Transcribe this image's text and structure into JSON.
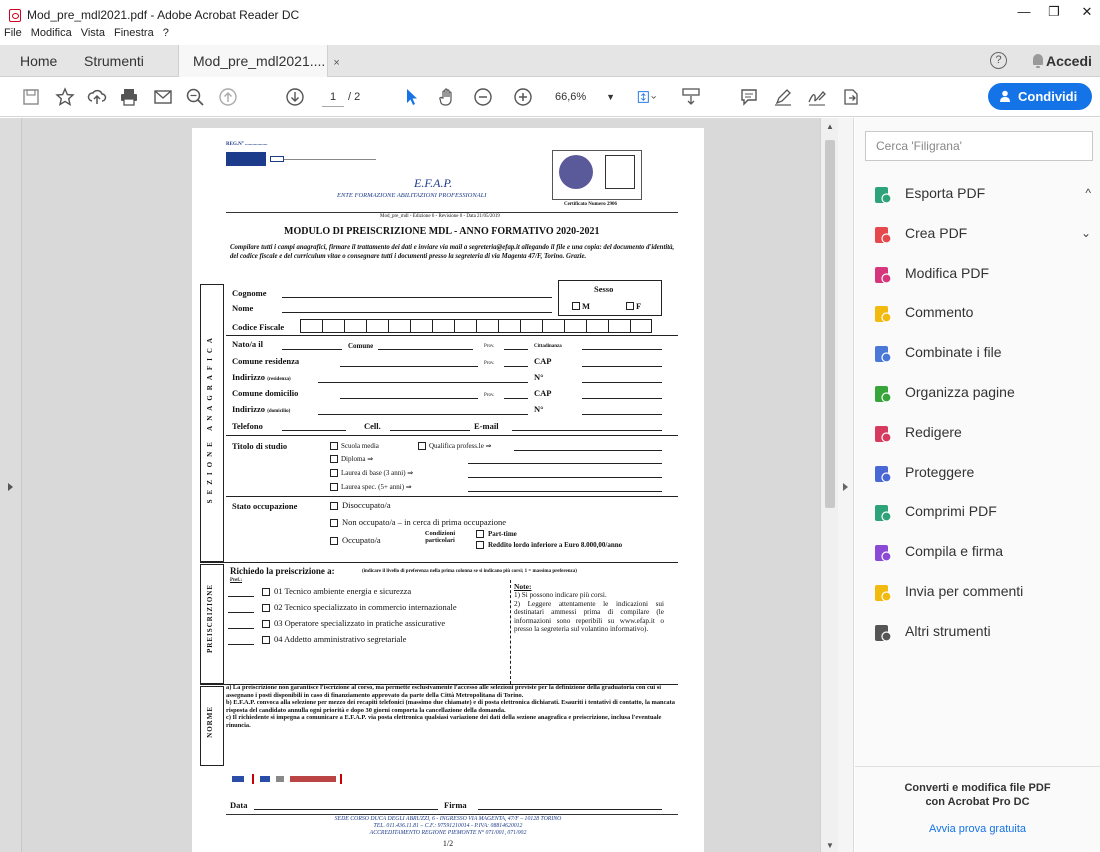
{
  "window": {
    "title": "Mod_pre_mdl2021.pdf - Adobe Acrobat Reader DC",
    "controls": [
      "—",
      "❐",
      "✕"
    ]
  },
  "menu": [
    "File",
    "Modifica",
    "Vista",
    "Finestra",
    "?"
  ],
  "tabs": {
    "home": "Home",
    "tools": "Strumenti",
    "doc": "Mod_pre_mdl2021....",
    "doc_close": "×",
    "signin": "Accedi",
    "help": "?"
  },
  "toolbar": {
    "page_current": "1",
    "page_total": "/ 2",
    "zoom": "66,6%",
    "share": "Condividi"
  },
  "right_panel": {
    "search_placeholder": "Cerca 'Filigrana'",
    "tools": [
      {
        "label": "Esporta PDF",
        "color": "#2ea37a",
        "chevron": "^"
      },
      {
        "label": "Crea PDF",
        "color": "#e5484d",
        "chevron": "⌄"
      },
      {
        "label": "Modifica PDF",
        "color": "#d6367c"
      },
      {
        "label": "Commento",
        "color": "#f2b90f"
      },
      {
        "label": "Combinate i file",
        "color": "#4a78d8"
      },
      {
        "label": "Organizza pagine",
        "color": "#37a63a"
      },
      {
        "label": "Redigere",
        "color": "#d63b5f"
      },
      {
        "label": "Proteggere",
        "color": "#4a67d6"
      },
      {
        "label": "Comprimi PDF",
        "color": "#2ea37a"
      },
      {
        "label": "Compila e firma",
        "color": "#8a4ad6"
      },
      {
        "label": "Invia per commenti",
        "color": "#f2b90f"
      },
      {
        "label": "Altri strumenti",
        "color": "#555555"
      }
    ],
    "footer_title": "Converti e modifica file PDF con Acrobat Pro DC",
    "footer_link": "Avvia prova gratuita"
  },
  "pdf": {
    "reg": "REG.N° ..................",
    "org_abbr": "E.F.A.P.",
    "org_name": "ENTE FORMAZIONE ABILITAZIONI PROFESSIONALI",
    "cert": "Certificato Numero 2906",
    "mod_line": "Mod_pre_mdl - Edizione 6 - Revisione 0 - Data 21/05/2019",
    "title": "MODULO DI PREISCRIZIONE MDL - ANNO FORMATIVO 2020-2021",
    "intro": "Compilare tutti i campi anagrafici, firmare il trattamento dei dati e inviare via mail a segreteria@efap.it allegando il file e una copia: del documento d'identità, del codice fiscale e del curriculum vitae o consegnare tutti i documenti presso la segreteria di via Magenta 47/F, Torino. Grazie.",
    "sections": {
      "anagrafica": "SEZIONE ANAGRAFICA",
      "prescrizione": "PREISCRIZIONE",
      "norme": "NORME"
    },
    "fields": {
      "cognome": "Cognome",
      "nome": "Nome",
      "sesso": "Sesso",
      "m": "M",
      "f": "F",
      "codice_fiscale": "Codice Fiscale",
      "nato": "Nato/a il",
      "comune": "Comune",
      "prov": "Prov.",
      "cittadinanza": "Cittadinanza",
      "comune_res": "Comune residenza",
      "cap": "CAP",
      "indirizzo": "Indirizzo",
      "residenza": "(residenza)",
      "n": "N°",
      "comune_dom": "Comune domicilio",
      "domicilio": "(domicilio)",
      "telefono": "Telefono",
      "cell": "Cell.",
      "email": "E-mail"
    },
    "studio": {
      "label": "Titolo di studio",
      "opts": [
        "Scuola media",
        "Qualifica profess.le ⇒",
        "Diploma ⇒",
        "Laurea di base (3 anni) ⇒",
        "Laurea spec. (5+ anni) ⇒"
      ]
    },
    "occupazione": {
      "label": "Stato occupazione",
      "opts": [
        "Disoccupato/a",
        "Non occupato/a – in cerca di prima occupazione",
        "Occupato/a"
      ],
      "cond": "Condizioni particolari",
      "part": "Part-time",
      "reddito": "Reddito lordo inferiore a Euro 8.000,00/anno"
    },
    "richiedo": "Richiedo la preiscrizione a:",
    "richiedo_note": "(indicare il livello di preferenza nella prima colonna se si indicano più corsi; 1 = massima preferenza)",
    "pref": "Pref.:",
    "corsi": [
      "01 Tecnico ambiente energia e sicurezza",
      "02 Tecnico specializzato in commercio internazionale",
      "03 Operatore specializzato in pratiche assicurative",
      "04 Addetto amministrativo segretariale"
    ],
    "note_title": "Note:",
    "notes": [
      "1)  Si possono indicare più corsi.",
      "2)  Leggere attentamente le indicazioni sui destinatari ammessi prima di compilare (le informazioni sono reperibili su www.efap.it o presso la segreteria sul volantino informativo)."
    ],
    "norme": [
      "a)  La preiscrizione non garantisce l'iscrizione al corso, ma permette esclusivamente l'accesso alle selezioni previste per la definizione della graduatoria con cui si assegnano i posti disponibili in caso di finanziamento approvato da parte della Città Metropolitana di Torino.",
      "b)  E.F.A.P. convoca alla selezione per mezzo dei recapiti telefonici (massimo due chiamate) e di posta elettronica dichiarati. Esauriti i tentativi di contatto, la mancata risposta del candidato annulla ogni priorità e dopo 30 giorni comporta la cancellazione della domanda.",
      "c)  Il richiedente si impegna a comunicare a E.F.A.P. via posta elettronica qualsiasi variazione dei dati della sezione anagrafica e preiscrizione, inclusa l'eventuale rinuncia."
    ],
    "data": "Data",
    "firma": "Firma",
    "footer1": "SEDE CORSO DUCA DEGLI ABRUZZI, 6 - INGRESSO VIA MAGENTA, 47/F – 10128 TORINO",
    "footer2": "TEL. 011.436.11.81 – C.F.: 97591210014 - P.IVA: 08814620012",
    "footer3": "ACCREDITAMENTO REGIONE PIEMONTE N° 071/001, 071/002",
    "pageno": "1/2"
  }
}
